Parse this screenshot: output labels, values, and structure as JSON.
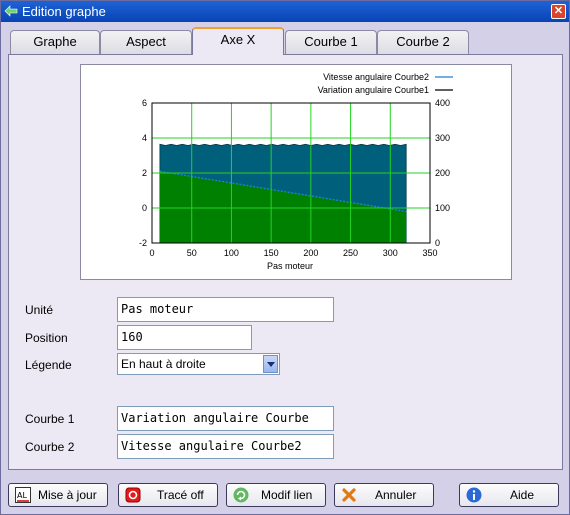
{
  "window": {
    "title": "Edition graphe",
    "close_glyph": "✕"
  },
  "tabs": [
    {
      "label": "Graphe"
    },
    {
      "label": "Aspect"
    },
    {
      "label": "Axe X"
    },
    {
      "label": "Courbe 1"
    },
    {
      "label": "Courbe 2"
    }
  ],
  "active_tab": "Axe X",
  "chart_data": {
    "type": "area",
    "x_label": "Pas moteur",
    "x_ticks": [
      "0",
      "50",
      "100",
      "150",
      "200",
      "250",
      "300",
      "350"
    ],
    "y_left_ticks": [
      "6",
      "4",
      "2",
      "0",
      "-2"
    ],
    "y_right_ticks": [
      "400",
      "300",
      "200",
      "100",
      "0"
    ],
    "x_range": [
      0,
      350
    ],
    "y_left_range": [
      -2,
      6
    ],
    "y_right_range": [
      0,
      400
    ],
    "grid": true,
    "legend_position": "top-right",
    "legend": [
      {
        "label": "Vitesse angulaire Courbe2",
        "color": "#1f7fd8"
      },
      {
        "label": "Variation angulaire Courbe1",
        "color": "#000000"
      }
    ],
    "series": [
      {
        "name": "Vitesse angulaire Courbe2",
        "axis": "right",
        "color": "#005f7a",
        "x": [
          10,
          320
        ],
        "values": [
          280,
          280
        ]
      },
      {
        "name": "Variation angulaire Courbe1",
        "axis": "left",
        "color": "#008000",
        "x": [
          10,
          320
        ],
        "values": [
          2.1,
          -0.2
        ]
      }
    ]
  },
  "form": {
    "unite_label": "Unité",
    "unite_value": "Pas moteur",
    "position_label": "Position",
    "position_value": "160",
    "legende_label": "Légende",
    "legende_value": "En haut à droite",
    "courbe1_label": "Courbe 1",
    "courbe1_value": "Variation angulaire Courbe",
    "courbe2_label": "Courbe 2",
    "courbe2_value": "Vitesse angulaire Courbe2"
  },
  "buttons": {
    "maj": "Mise à jour",
    "trace": "Tracé off",
    "modif": "Modif lien",
    "annuler": "Annuler",
    "aide": "Aide"
  },
  "icons": {
    "maj_icon_text": "AL"
  }
}
